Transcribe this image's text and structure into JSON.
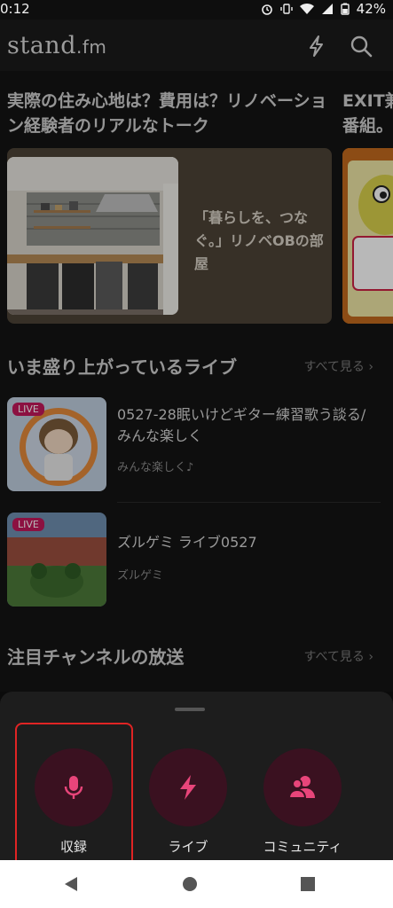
{
  "status": {
    "time": "0:12",
    "battery": "42%"
  },
  "header": {
    "logo_main": "stand",
    "logo_suffix": ".fm"
  },
  "featured": [
    {
      "title": "実際の住み心地は？費用は？リノベーション経験者のリアルなトーク",
      "caption": "「暮らしを、つなぐ。」リノベOBの部屋"
    },
    {
      "title": "EXIT兼番組。"
    }
  ],
  "live_section": {
    "title": "いま盛り上がっているライブ",
    "see_all": "すべて見る",
    "items": [
      {
        "badge": "LIVE",
        "title": "0527-28眠いけどギター練習歌う談る/みんな楽しく",
        "host": "みんな楽しく♪"
      },
      {
        "badge": "LIVE",
        "title": "ズルゲミ ライブ0527",
        "host": "ズルゲミ"
      }
    ]
  },
  "channel_section": {
    "title": "注目チャンネルの放送",
    "see_all": "すべて見る"
  },
  "sheet": {
    "buttons": [
      {
        "label": "収録",
        "icon": "microphone-icon"
      },
      {
        "label": "ライブ",
        "icon": "lightning-icon"
      },
      {
        "label": "コミュニティ",
        "icon": "community-icon"
      }
    ]
  },
  "colors": {
    "accent": "#e8457a",
    "sheet_circle": "#3a1120",
    "highlight": "#e02424"
  }
}
